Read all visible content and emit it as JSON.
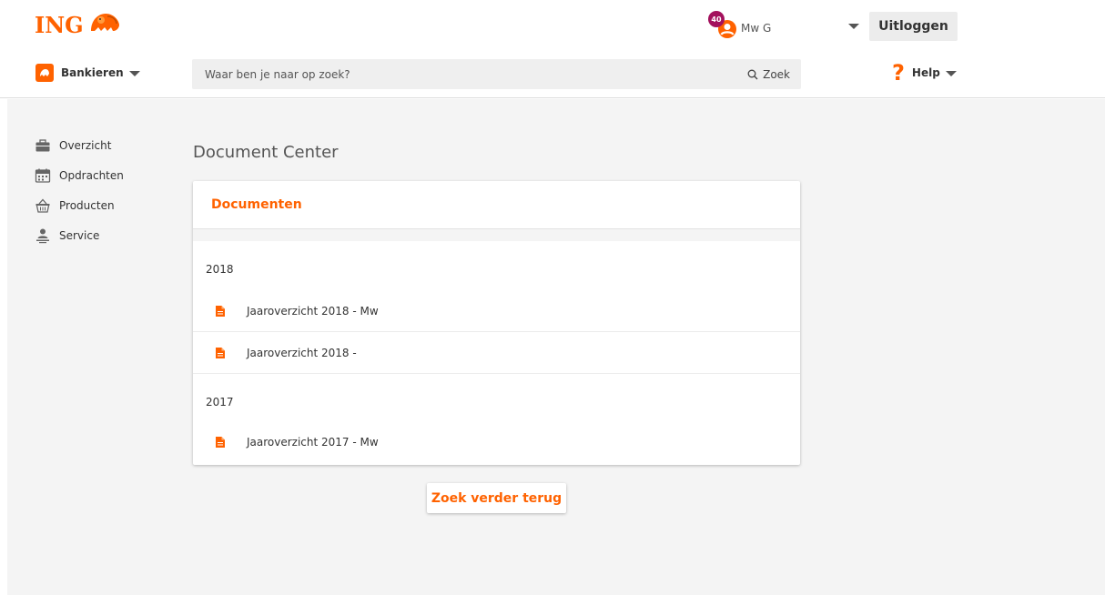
{
  "brand": {
    "logo_text": "ING",
    "accent_color": "#ff6200"
  },
  "header": {
    "user": {
      "badge_count": "40",
      "name": "Mw G"
    },
    "logout_label": "Uitloggen",
    "bank_menu_label": "Bankieren",
    "search": {
      "placeholder": "Waar ben je naar op zoek?",
      "button_label": "Zoek",
      "icon": "search-icon"
    },
    "help_label": "Help"
  },
  "sidebar": {
    "items": [
      {
        "label": "Overzicht",
        "icon": "briefcase-icon"
      },
      {
        "label": "Opdrachten",
        "icon": "calendar-icon"
      },
      {
        "label": "Producten",
        "icon": "basket-icon"
      },
      {
        "label": "Service",
        "icon": "person-icon"
      }
    ]
  },
  "main": {
    "page_title": "Document Center",
    "card_title": "Documenten",
    "groups": [
      {
        "year": "2018",
        "documents": [
          {
            "label": "Jaaroverzicht 2018 - Mw"
          },
          {
            "label": "Jaaroverzicht 2018 - "
          }
        ]
      },
      {
        "year": "2017",
        "documents": [
          {
            "label": "Jaaroverzicht 2017 - Mw"
          }
        ]
      }
    ],
    "more_button_label": "Zoek verder terug"
  }
}
